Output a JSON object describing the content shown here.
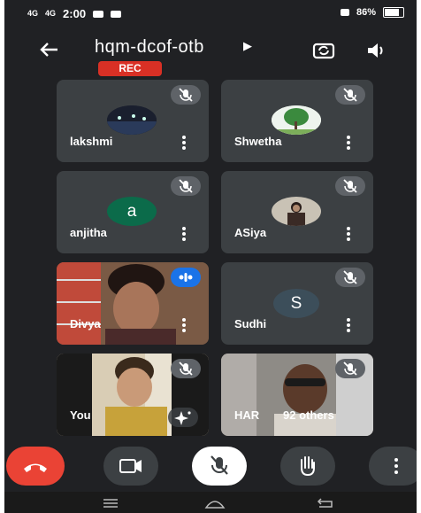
{
  "statusbar": {
    "signal1": "4G",
    "signal2": "4G",
    "time": "2:00",
    "battery_pct": "86%"
  },
  "header": {
    "meeting_code": "hqm-dcof-otb",
    "rec_label": "REC"
  },
  "participants": [
    {
      "name": "lakshmi",
      "avatar": "photo",
      "muted": true
    },
    {
      "name": "Shwetha",
      "avatar": "photo",
      "muted": true
    },
    {
      "name": "anjitha",
      "avatar_letter": "a",
      "avatar_color": "#0b6b4a",
      "muted": true
    },
    {
      "name": "ASiya",
      "avatar": "photo",
      "muted": true
    },
    {
      "name": "Divya",
      "avatar": "video",
      "speaking": true
    },
    {
      "name": "Sudhi",
      "avatar_letter": "S",
      "avatar_color": "#3c4e5a",
      "muted": true
    },
    {
      "name": "You",
      "avatar": "video",
      "muted": true
    },
    {
      "name": "HAR",
      "avatar": "video",
      "muted": true,
      "others_label": "92 others"
    }
  ],
  "colors": {
    "background": "#202124",
    "tile": "#3c4043",
    "rec": "#d93025",
    "end_call": "#ea4335",
    "speaking": "#1a73e8"
  },
  "controls": [
    "end-call",
    "camera",
    "mic-muted",
    "raise-hand",
    "more"
  ]
}
